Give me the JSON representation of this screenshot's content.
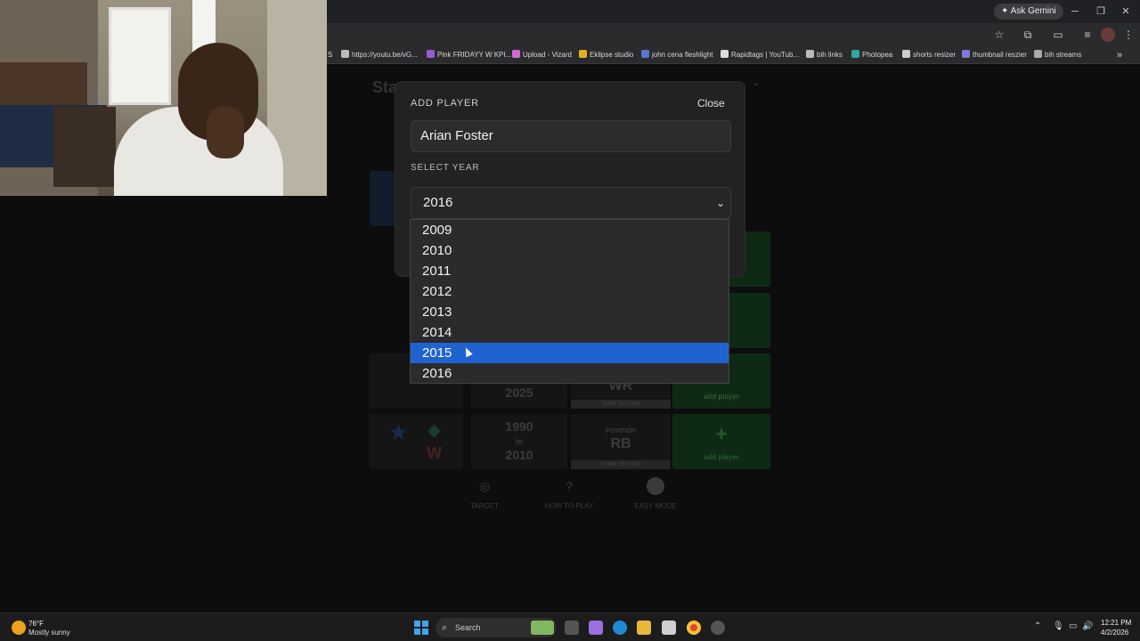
{
  "browser": {
    "ask_gemini": "Ask Gemini",
    "bookmarks": [
      {
        "label": "S"
      },
      {
        "label": "https://youtu.be/vG..."
      },
      {
        "label": "Pink FRIDAYY W KPI..."
      },
      {
        "label": "Upload - Vizard"
      },
      {
        "label": "Eklipse studio"
      },
      {
        "label": "john cena fleshlight"
      },
      {
        "label": "Rapidtags | YouTub..."
      },
      {
        "label": "bih links"
      },
      {
        "label": "Photopea"
      },
      {
        "label": "shorts resizer"
      },
      {
        "label": "thumbnail reszier"
      },
      {
        "label": "bih streams"
      }
    ],
    "more_bookmarks": "»"
  },
  "background_page": {
    "title_fragment": "Sta",
    "rows": [
      {
        "years_top": "",
        "years_mid": "",
        "years_bottom": "2025",
        "position": "WR",
        "same_season": "SAME SEASON"
      },
      {
        "years_top": "1990",
        "years_mid": "to",
        "years_bottom": "2010",
        "position": "RB",
        "position_label": "POSITION",
        "same_season": "SAME SEASON"
      }
    ],
    "add_player_plus": "+",
    "add_player_label": "add player",
    "options": [
      {
        "label": "TARGET",
        "icon": "target-icon"
      },
      {
        "label": "HOW TO PLAY",
        "icon": "question-icon"
      },
      {
        "label": "EASY MODE",
        "icon": "toggle-icon"
      }
    ]
  },
  "modal": {
    "title": "ADD PLAYER",
    "close_label": "Close",
    "player_name": "Arian Foster",
    "select_label": "SELECT YEAR",
    "selected_year": "2016",
    "year_options": [
      "2009",
      "2010",
      "2011",
      "2012",
      "2013",
      "2014",
      "2015",
      "2016"
    ],
    "highlighted_year": "2015",
    "highlight_color": "#1f63d1"
  },
  "taskbar": {
    "weather_temp": "76°F",
    "weather_desc": "Mostly sunny",
    "search_label": "Search",
    "time": "12:21 PM",
    "date": "4/2/2026"
  }
}
